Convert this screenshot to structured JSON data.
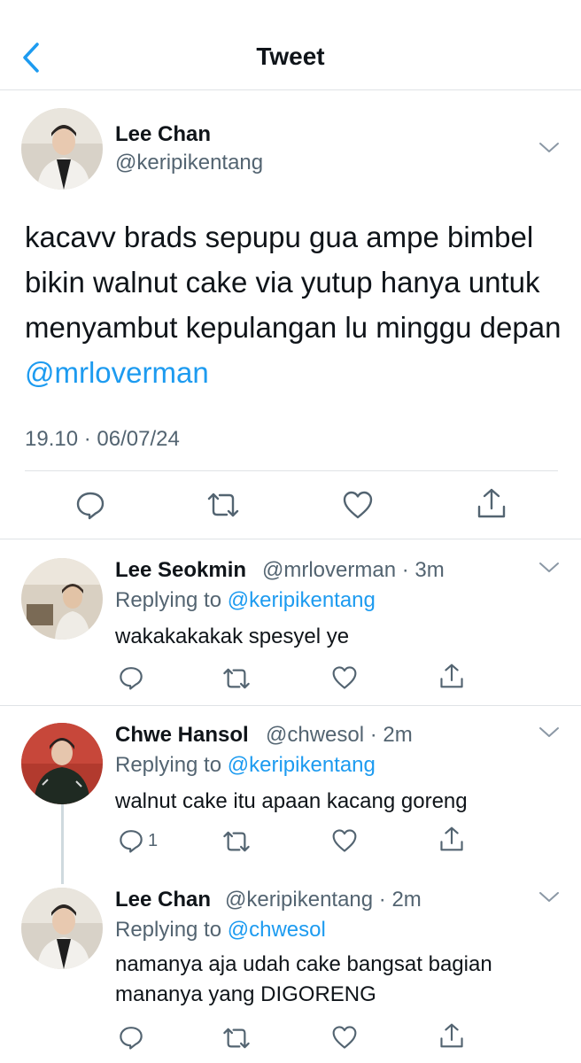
{
  "header": {
    "title": "Tweet"
  },
  "main_tweet": {
    "name": "Lee Chan",
    "handle": "@keripikentang",
    "text": "kacavv brads sepupu gua ampe bimbel bikin walnut cake via yutup hanya untuk menyambut kepulangan lu minggu depan ",
    "mention": "@mrloverman",
    "timestamp": "19.10 · 06/07/24"
  },
  "replies": [
    {
      "name": "Lee Seokmin",
      "meta": "@mrloverman · 3m",
      "replying_label": "Replying to ",
      "replying_to": "@keripikentang",
      "text": "wakakakakak spesyel ye",
      "reply_count": ""
    },
    {
      "name": "Chwe Hansol",
      "meta": "@chwesol · 2m",
      "replying_label": "Replying to ",
      "replying_to": "@keripikentang",
      "text": "walnut cake itu apaan kacang goreng",
      "reply_count": "1"
    },
    {
      "name": "Lee Chan",
      "meta": "@keripikentang · 2m",
      "replying_label": "Replying to ",
      "replying_to": "@chwesol",
      "text": "namanya aja udah cake bangsat bagian mananya yang DIGORENG",
      "reply_count": ""
    }
  ],
  "icons": {
    "back": "chevron-left-icon",
    "more": "chevron-down-icon",
    "reply": "comment-icon",
    "retweet": "retweet-icon",
    "like": "heart-icon",
    "share": "share-icon"
  },
  "colors": {
    "accent": "#1d9bf0",
    "secondary_text": "#536471",
    "divider": "#dfe3e6"
  }
}
